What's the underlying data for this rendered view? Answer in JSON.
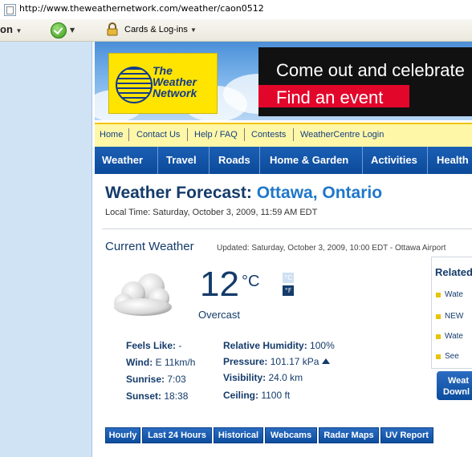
{
  "browser": {
    "url": "http://www.theweathernetwork.com/weather/caon0512",
    "toolbar_brand": "on",
    "cards_label": "Cards & Log-ins"
  },
  "banner": {
    "logo_line1": "The",
    "logo_line2": "Weather",
    "logo_line3": "Network",
    "ad_line1": "Come out and celebrate",
    "ad_line2": "Find an event"
  },
  "yellow_nav": [
    "Home",
    "Contact Us",
    "Help / FAQ",
    "Contests",
    "WeatherCentre Login"
  ],
  "blue_nav": [
    "Weather",
    "Travel",
    "Roads",
    "Home & Garden",
    "Activities",
    "Health"
  ],
  "page": {
    "title_prefix": "Weather Forecast:",
    "title_city": "Ottawa, Ontario",
    "local_time": "Local Time: Saturday, October 3, 2009, 11:59 AM EDT"
  },
  "current": {
    "heading": "Current Weather",
    "updated": "Updated: Saturday, October 3, 2009, 10:00 EDT - Ottawa Airport",
    "temperature": "12",
    "unit": "°C",
    "unit_c": "°C",
    "unit_f": "°F",
    "condition": "Overcast",
    "feels_like_label": "Feels Like:",
    "feels_like_value": "-",
    "wind_label": "Wind:",
    "wind_value": "E 11km/h",
    "sunrise_label": "Sunrise:",
    "sunrise_value": "7:03",
    "sunset_label": "Sunset:",
    "sunset_value": "18:38",
    "humidity_label": "Relative Humidity:",
    "humidity_value": "100%",
    "pressure_label": "Pressure:",
    "pressure_value": "101.17 kPa",
    "visibility_label": "Visibility:",
    "visibility_value": "24.0 km",
    "ceiling_label": "Ceiling:",
    "ceiling_value": "1100 ft"
  },
  "tabs": [
    "Hourly",
    "Last 24 Hours",
    "Historical",
    "Webcams",
    "Radar Maps",
    "UV Report"
  ],
  "related": {
    "title": "Related",
    "items": [
      "Wate",
      "NEW",
      "Wate",
      "See"
    ],
    "button_line1": "Weat",
    "button_line2": "Downl"
  },
  "colors": {
    "navy": "#143b6a",
    "link_blue": "#1f77c9",
    "nav_blue": "#0c4a9a",
    "yellow": "#ffe400"
  }
}
